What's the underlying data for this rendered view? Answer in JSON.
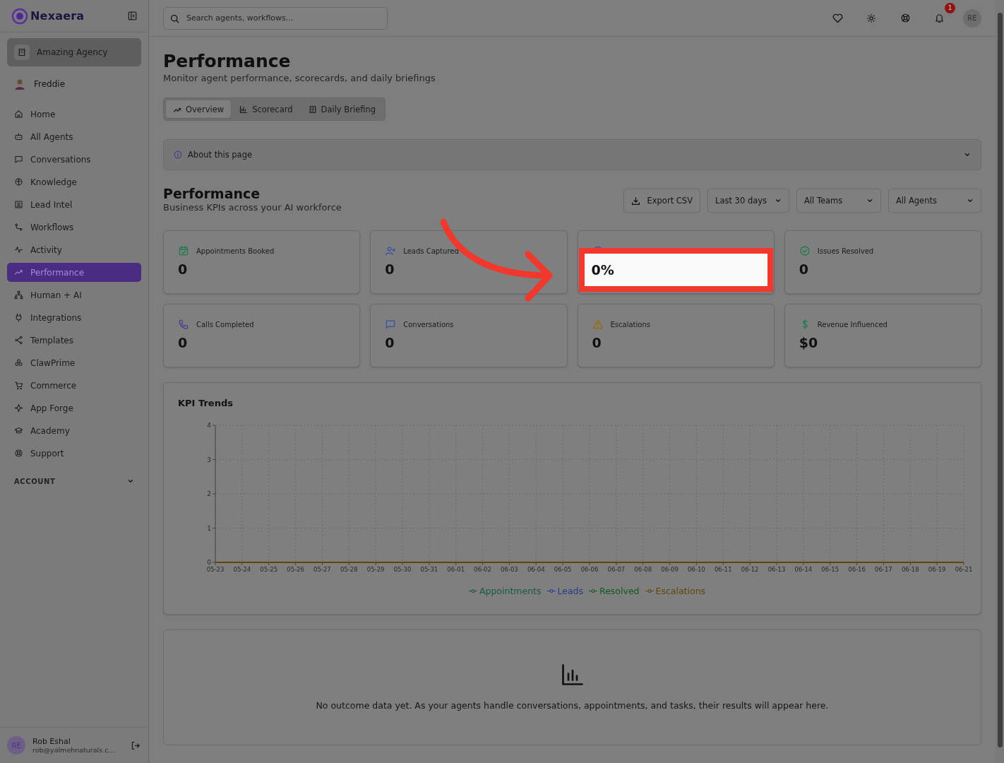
{
  "brand": {
    "name": "Nexaera"
  },
  "sidebar": {
    "workspace": "Amazing Agency",
    "user": "Freddie",
    "items": [
      {
        "label": "Home",
        "selected": false
      },
      {
        "label": "All Agents",
        "selected": false
      },
      {
        "label": "Conversations",
        "selected": false
      },
      {
        "label": "Knowledge",
        "selected": false
      },
      {
        "label": "Lead Intel",
        "selected": false
      },
      {
        "label": "Workflows",
        "selected": false
      },
      {
        "label": "Activity",
        "selected": false
      },
      {
        "label": "Performance",
        "selected": true
      },
      {
        "label": "Human + AI",
        "selected": false
      },
      {
        "label": "Integrations",
        "selected": false
      },
      {
        "label": "Templates",
        "selected": false
      },
      {
        "label": "ClawPrime",
        "selected": false
      },
      {
        "label": "Commerce",
        "selected": false
      },
      {
        "label": "App Forge",
        "selected": false
      },
      {
        "label": "Academy",
        "selected": false
      },
      {
        "label": "Support",
        "selected": false
      }
    ],
    "section": "ACCOUNT",
    "account": {
      "initials": "RE",
      "name": "Rob Eshal",
      "email": "rob@yalmehnaturals.c..."
    }
  },
  "topbar": {
    "search": {
      "placeholder": "Search agents, workflows..."
    },
    "notifications": "1",
    "avatar": "RE"
  },
  "page": {
    "title": "Performance",
    "subtitle": "Monitor agent performance, scorecards, and daily briefings"
  },
  "tabs": [
    {
      "label": "Overview",
      "selected": true
    },
    {
      "label": "Scorecard",
      "selected": false
    },
    {
      "label": "Daily Briefing",
      "selected": false
    }
  ],
  "about": {
    "label": "About this page"
  },
  "section": {
    "title": "Performance",
    "subtitle": "Business KPIs across your AI workforce",
    "export": "Export CSV",
    "filters": [
      "Last 30 days",
      "All Teams",
      "All Agents"
    ]
  },
  "kpis": [
    {
      "label": "Appointments Booked",
      "value": "0",
      "highlighted": false
    },
    {
      "label": "Leads Captured",
      "value": "0",
      "highlighted": false
    },
    {
      "value": "0%",
      "highlighted": true
    },
    {
      "label": "Issues Resolved",
      "value": "0",
      "highlighted": false
    },
    {
      "label": "Calls Completed",
      "value": "0",
      "highlighted": false
    },
    {
      "label": "Conversations",
      "value": "0",
      "highlighted": false
    },
    {
      "label": "Escalations",
      "value": "0",
      "highlighted": false
    },
    {
      "label": "Revenue Influenced",
      "value": "$0",
      "highlighted": false
    }
  ],
  "chart": {
    "title": "KPI Trends",
    "chart_data": {
      "type": "line",
      "categories": [
        "05-23",
        "05-24",
        "05-25",
        "05-26",
        "05-27",
        "05-28",
        "05-29",
        "05-30",
        "05-31",
        "06-01",
        "06-02",
        "06-03",
        "06-04",
        "06-05",
        "06-06",
        "06-07",
        "06-08",
        "06-09",
        "06-10",
        "06-11",
        "06-12",
        "06-13",
        "06-14",
        "06-15",
        "06-16",
        "06-17",
        "06-18",
        "06-19",
        "06-21"
      ],
      "ylim": [
        0,
        4
      ],
      "yticks": [
        0,
        1,
        2,
        3,
        4
      ],
      "grid": true,
      "series": [
        {
          "name": "Appointments",
          "color": "#155c3c",
          "values": [
            null,
            null,
            null,
            null,
            null,
            null,
            null,
            null,
            null,
            null,
            null,
            null,
            null,
            null,
            null,
            null,
            null,
            null,
            null,
            null,
            null,
            null,
            null,
            null,
            null,
            null,
            null,
            null,
            null
          ]
        },
        {
          "name": "Leads",
          "color": "#233c8c",
          "values": [
            null,
            null,
            null,
            null,
            null,
            null,
            null,
            null,
            null,
            null,
            null,
            null,
            null,
            null,
            null,
            null,
            null,
            null,
            null,
            null,
            null,
            null,
            null,
            null,
            null,
            null,
            null,
            null,
            null
          ]
        },
        {
          "name": "Resolved",
          "color": "#135a20",
          "values": [
            null,
            null,
            null,
            null,
            null,
            null,
            null,
            null,
            null,
            null,
            null,
            null,
            null,
            null,
            null,
            null,
            null,
            null,
            null,
            null,
            null,
            null,
            null,
            null,
            null,
            null,
            null,
            null,
            null
          ]
        },
        {
          "name": "Escalations",
          "color": "#5e4608",
          "values": [
            0,
            0,
            0,
            0,
            0,
            0,
            0,
            0,
            0,
            0,
            0,
            0,
            0,
            0,
            0,
            0,
            0,
            0,
            0,
            0,
            0,
            0,
            0,
            0,
            0,
            0,
            0,
            0,
            0
          ]
        }
      ]
    }
  },
  "empty_state": {
    "message": "No outcome data yet. As your agents handle conversations, appointments, and tasks, their results will appear here."
  },
  "annotation": {
    "arrow": true
  }
}
